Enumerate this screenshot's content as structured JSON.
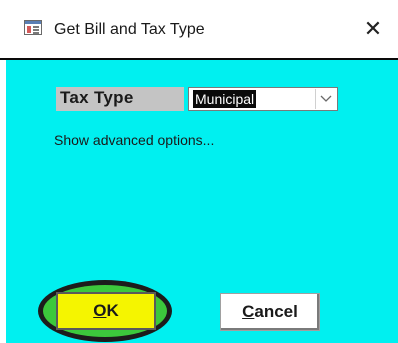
{
  "window": {
    "title": "Get Bill and Tax Type",
    "close_glyph": "✕",
    "icon": "form-window-icon"
  },
  "form": {
    "tax_type_label": "Tax Type",
    "tax_type_value": "Municipal",
    "advanced_link": "Show advanced options...",
    "ok_access_key": "O",
    "ok_rest": "K",
    "cancel_access_key": "C",
    "cancel_rest": "ancel"
  },
  "colors": {
    "client_background": "#00f0f0",
    "ok_button": "#f5f500",
    "highlight_ring": "#3cc83c"
  }
}
